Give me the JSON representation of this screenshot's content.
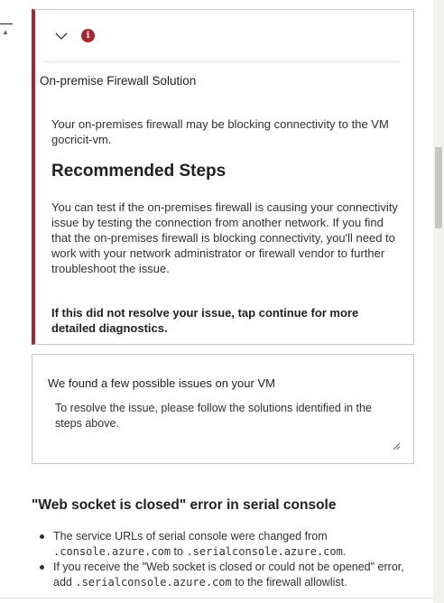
{
  "issue_card": {
    "title": "On-premise Firewall Solution",
    "description": "Your on-premises firewall may be blocking connectivity to the VM gocricit-vm.",
    "recommended_heading": "Recommended Steps",
    "recommended_body": "You can test if the on-premises firewall is causing your connectivity issue by testing the connection from another network. If you find that the on-premises firewall is blocking connectivity, you'll need to work with your network administrator or firewall vendor to further troubleshoot the issue.",
    "not_resolved": "If this did not resolve your issue, tap continue for more detailed diagnostics.",
    "error_icon": "error-info-icon",
    "chevron_icon": "chevron-down-icon",
    "accent_color": "#a4262c"
  },
  "found_card": {
    "title": "We found a few possible issues on your VM",
    "text": "To resolve the issue, please follow the solutions identified in the steps above."
  },
  "websocket_section": {
    "heading": "\"Web socket is closed\" error in serial console",
    "bullet1": {
      "prefix": "The service URLs of serial console were changed from",
      "code1": ".console.azure.com",
      "mid": "to",
      "code2": ".serialconsole.azure.com",
      "suffix": "."
    },
    "bullet2": {
      "prefix": "If you receive the \"Web socket is closed or could not be opened\" error, add",
      "code": ".serialconsole.azure.com",
      "suffix": "to the firewall allowlist."
    }
  }
}
